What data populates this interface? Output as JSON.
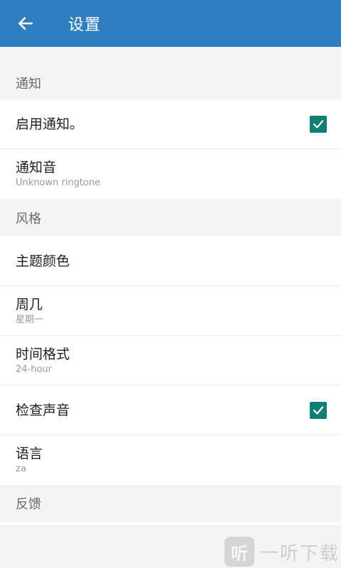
{
  "appbar": {
    "title": "设置",
    "back_icon": "arrow-left-icon",
    "background": "#2f7fc0"
  },
  "sections": {
    "notification": {
      "header": "通知",
      "enable": {
        "label": "启用通知。",
        "checked": true
      },
      "sound": {
        "label": "通知音",
        "sub": "Unknown ringtone"
      }
    },
    "style": {
      "header": "风格",
      "theme": {
        "label": "主题颜色"
      },
      "week": {
        "label": "周几",
        "sub": "星期一"
      },
      "time_format": {
        "label": "时间格式",
        "sub": "24-hour"
      },
      "check_sound": {
        "label": "检查声音",
        "checked": true
      },
      "language": {
        "label": "语言",
        "sub": "za"
      }
    },
    "feedback": {
      "header": "反馈"
    }
  },
  "colors": {
    "checkbox": "#0f7f74"
  },
  "watermark": {
    "logo": "听",
    "text": "一听下载"
  }
}
